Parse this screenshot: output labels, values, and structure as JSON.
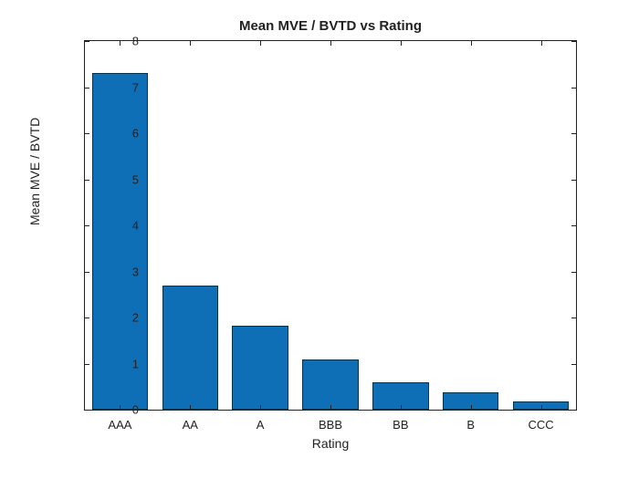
{
  "chart_data": {
    "type": "bar",
    "title": "Mean MVE / BVTD vs Rating",
    "xlabel": "Rating",
    "ylabel": "Mean MVE / BVTD",
    "categories": [
      "AAA",
      "AA",
      "A",
      "BBB",
      "BB",
      "B",
      "CCC"
    ],
    "values": [
      7.3,
      2.7,
      1.83,
      1.08,
      0.6,
      0.38,
      0.17
    ],
    "ylim": [
      0,
      8
    ],
    "yticks": [
      0,
      1,
      2,
      3,
      4,
      5,
      6,
      7,
      8
    ],
    "bar_color": "#0f6fb6"
  }
}
